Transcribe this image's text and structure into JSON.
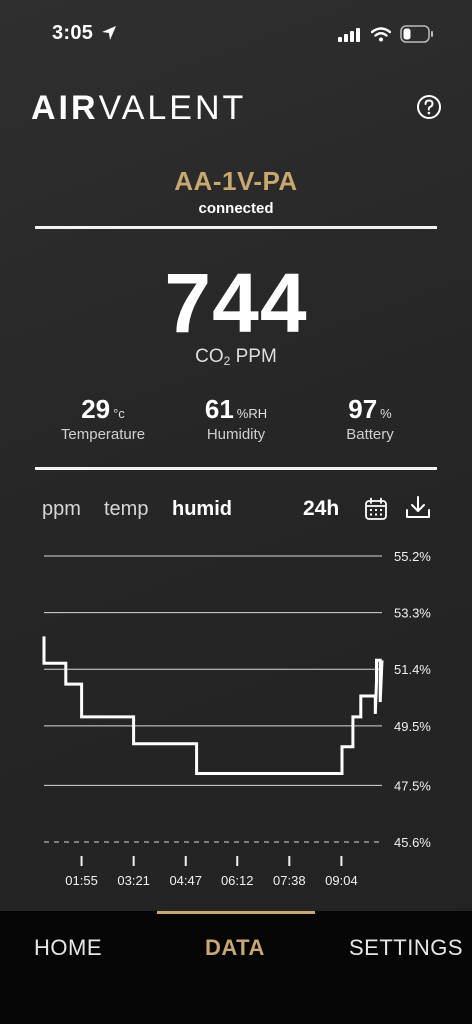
{
  "status_bar": {
    "time": "3:05"
  },
  "header": {
    "brand_bold": "AIR",
    "brand_light": "VALENT"
  },
  "device": {
    "name": "AA-1V-PA",
    "status": "connected"
  },
  "reading": {
    "value": "744",
    "unit_prefix": "CO",
    "unit_sub": "2",
    "unit_suffix": " PPM"
  },
  "stats": {
    "temperature": {
      "value": "29",
      "unit": "°c",
      "label": "Temperature"
    },
    "humidity": {
      "value": "61",
      "unit": "%RH",
      "label": "Humidity"
    },
    "battery": {
      "value": "97",
      "unit": "%",
      "label": "Battery"
    }
  },
  "chart_tabs": {
    "ppm": "ppm",
    "temp": "temp",
    "humid": "humid",
    "range": "24h"
  },
  "chart_data": {
    "type": "line",
    "title": "",
    "xlabel": "",
    "ylabel": "",
    "x_ticks": [
      "01:55",
      "03:21",
      "04:47",
      "06:12",
      "07:38",
      "09:04"
    ],
    "y_ticks": [
      "55.2%",
      "53.3%",
      "51.4%",
      "49.5%",
      "47.5%",
      "45.6%"
    ],
    "y_tick_values": [
      55.2,
      53.3,
      51.4,
      49.5,
      47.5,
      45.6
    ],
    "ylim": [
      45.6,
      55.2
    ],
    "x_start": "00:53",
    "x_end": "10:11",
    "grid": true,
    "series": [
      {
        "points": [
          [
            "00:53",
            52.5
          ],
          [
            "00:53",
            51.6
          ],
          [
            "01:14",
            51.6
          ],
          [
            "01:14",
            51.6
          ],
          [
            "01:29",
            51.6
          ],
          [
            "01:29",
            50.9
          ],
          [
            "01:55",
            50.9
          ],
          [
            "01:55",
            49.8
          ],
          [
            "03:21",
            49.8
          ],
          [
            "03:21",
            48.9
          ],
          [
            "05:05",
            48.9
          ],
          [
            "05:05",
            47.9
          ],
          [
            "09:05",
            47.9
          ],
          [
            "09:05",
            48.8
          ],
          [
            "09:23",
            48.8
          ],
          [
            "09:23",
            49.8
          ],
          [
            "09:36",
            49.8
          ],
          [
            "09:36",
            50.5
          ],
          [
            "10:00",
            50.5
          ],
          [
            "10:00",
            49.9
          ],
          [
            "10:02",
            51.0
          ],
          [
            "10:02",
            51.7
          ],
          [
            "10:08",
            51.7
          ],
          [
            "10:08",
            50.3
          ],
          [
            "10:11",
            51.7
          ]
        ]
      }
    ],
    "line_color": "#ffffff"
  },
  "bottom_nav": {
    "home": "HOME",
    "data": "DATA",
    "settings": "SETTINGS"
  },
  "colors": {
    "accent": "#c9a770",
    "background": "#262626",
    "nav_background": "#050505"
  }
}
